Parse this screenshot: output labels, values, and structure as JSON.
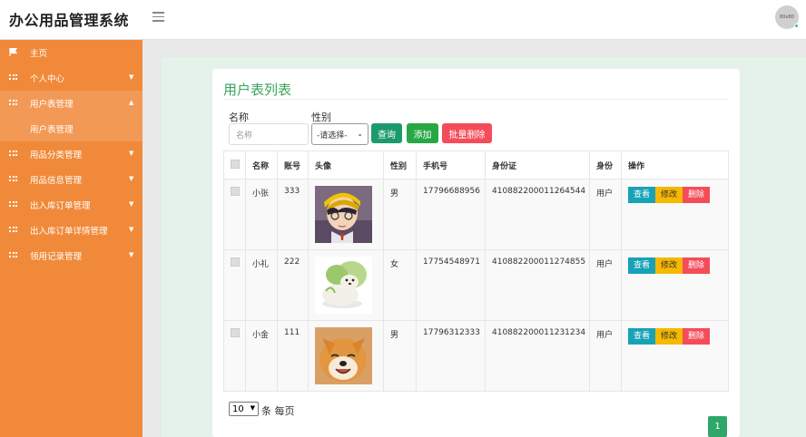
{
  "header": {
    "app_title": "办公用品管理系统",
    "avatar_text": "80x80",
    "menu_icon": "hamburger-icon"
  },
  "sidebar": {
    "items": [
      {
        "label": "主页",
        "icon": "flag-icon"
      },
      {
        "label": "个人中心",
        "icon": "grid-icon"
      },
      {
        "label": "用户表管理",
        "icon": "grid-icon",
        "expanded": true,
        "children": [
          "用户表管理"
        ]
      },
      {
        "label": "用品分类管理",
        "icon": "grid-icon"
      },
      {
        "label": "用品信息管理",
        "icon": "grid-icon"
      },
      {
        "label": "出入库订单管理",
        "icon": "grid-icon"
      },
      {
        "label": "出入库订单详情管理",
        "icon": "grid-icon"
      },
      {
        "label": "领用记录管理",
        "icon": "grid-icon"
      }
    ],
    "bg_color": "#f08a3a"
  },
  "main": {
    "title": "用户表列表",
    "filters": {
      "name_label": "名称",
      "name_placeholder": "名称",
      "gender_label": "性别",
      "gender_value": "-请选择-"
    },
    "buttons": {
      "query": "查询",
      "add": "添加",
      "batch_delete": "批量删除"
    },
    "table": {
      "headers": [
        "名称",
        "账号",
        "头像",
        "性别",
        "手机号",
        "身份证",
        "身份",
        "操作"
      ],
      "rows": [
        {
          "name": "小张",
          "account": "333",
          "gender": "男",
          "phone": "17796688956",
          "id_card": "410882200011264544",
          "role": "用户"
        },
        {
          "name": "小礼",
          "account": "222",
          "gender": "女",
          "phone": "17754548971",
          "id_card": "410882200011274855",
          "role": "用户"
        },
        {
          "name": "小金",
          "account": "111",
          "gender": "男",
          "phone": "17796312333",
          "id_card": "410882200011231234",
          "role": "用户"
        }
      ],
      "actions": {
        "view": "查看",
        "edit": "修改",
        "delete": "删除"
      }
    },
    "pagination": {
      "page_size": "10",
      "page_size_label": "条 每页",
      "current_page": "1"
    }
  },
  "colors": {
    "accent_green": "#3aa35a",
    "query": "#1d9a6c",
    "add": "#28a745",
    "danger": "#f44c5a",
    "view": "#17a2b8",
    "edit": "#f6b800"
  }
}
